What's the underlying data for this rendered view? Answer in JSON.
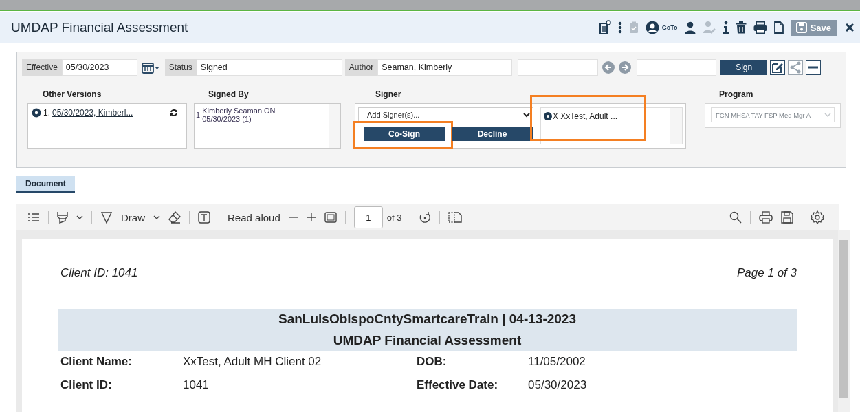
{
  "window": {
    "title": "UMDAP Financial Assessment"
  },
  "toolbar": {
    "icons": [
      {
        "kind": "document-gear",
        "disabled": false
      },
      {
        "kind": "dots",
        "disabled": false
      },
      {
        "kind": "clipboard",
        "disabled": true
      },
      {
        "kind": "user-circle",
        "disabled": false
      },
      {
        "kind": "goto",
        "label": "GoTo",
        "disabled": false
      },
      {
        "kind": "person",
        "disabled": false
      },
      {
        "kind": "person-edit",
        "disabled": true
      },
      {
        "kind": "info",
        "disabled": false
      },
      {
        "kind": "trash",
        "disabled": false
      },
      {
        "kind": "print",
        "disabled": false
      },
      {
        "kind": "page",
        "disabled": false
      }
    ],
    "save": {
      "label": "Save",
      "disabled": true
    }
  },
  "header": {
    "effective": {
      "label": "Effective",
      "value": "05/30/2023"
    },
    "status": {
      "label": "Status",
      "value": "Signed"
    },
    "author": {
      "label": "Author",
      "value": "Seaman, Kimberly"
    },
    "sign_button": "Sign"
  },
  "other_versions": {
    "heading": "Other Versions",
    "items": [
      {
        "number": "1.",
        "text": "05/30/2023, Kimberl...",
        "selected": true
      }
    ]
  },
  "signed_by": {
    "heading": "Signed By",
    "items": [
      {
        "number": "1.",
        "text": "Kimberly Seaman ON 05/30/2023 (1)"
      }
    ]
  },
  "signer": {
    "heading": "Signer",
    "placeholder": "Add Signer(s)...",
    "buttons": [
      {
        "label": "Co-Sign",
        "highlighted": true
      },
      {
        "label": "Decline",
        "highlighted": false
      }
    ],
    "signers": [
      {
        "text": "X XxTest, Adult ...",
        "highlighted": true
      }
    ]
  },
  "program": {
    "heading": "Program",
    "value": "FCN MHSA TAY FSP Med Mgr A",
    "disabled": true
  },
  "tabs": [
    {
      "label": "Document",
      "selected": true
    }
  ],
  "viewer": {
    "draw_label": "Draw",
    "read_aloud": "Read aloud",
    "page": "1",
    "page_count": "of 3"
  },
  "document": {
    "client_id": "Client ID: 1041",
    "page_label": "Page 1 of 3",
    "header_lines": [
      "SanLuisObispoCntySmartcareTrain | 04-13-2023",
      "UMDAP Financial Assessment"
    ],
    "fields": [
      {
        "label": "Client Name:",
        "value": "XxTest, Adult MH Client 02",
        "label_2": "DOB:",
        "value_2": "11/05/2002"
      },
      {
        "label": "Client ID:",
        "value": "1041",
        "label_2": "Effective Date:",
        "value_2": "05/30/2023"
      }
    ]
  }
}
